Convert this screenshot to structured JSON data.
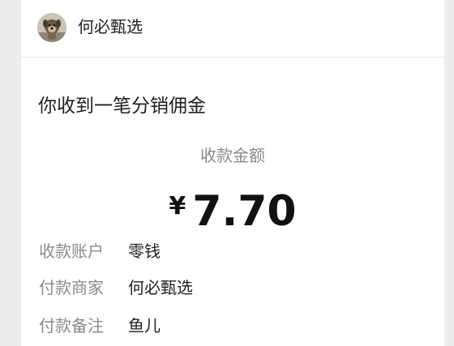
{
  "header": {
    "merchant_name": "何必甄选",
    "avatar_icon": "dog-avatar-icon"
  },
  "notice": {
    "title": "你收到一笔分销佣金"
  },
  "payment": {
    "amount_label": "收款金额",
    "currency_symbol": "¥",
    "amount": "7.70"
  },
  "details": [
    {
      "label": "收款账户",
      "value": "零钱"
    },
    {
      "label": "付款商家",
      "value": "何必甄选"
    },
    {
      "label": "付款备注",
      "value": "鱼儿"
    }
  ],
  "colors": {
    "background": "#ededed",
    "card": "#ffffff",
    "primary_text": "#1f1f1f",
    "secondary_text": "#8a8a8a"
  }
}
